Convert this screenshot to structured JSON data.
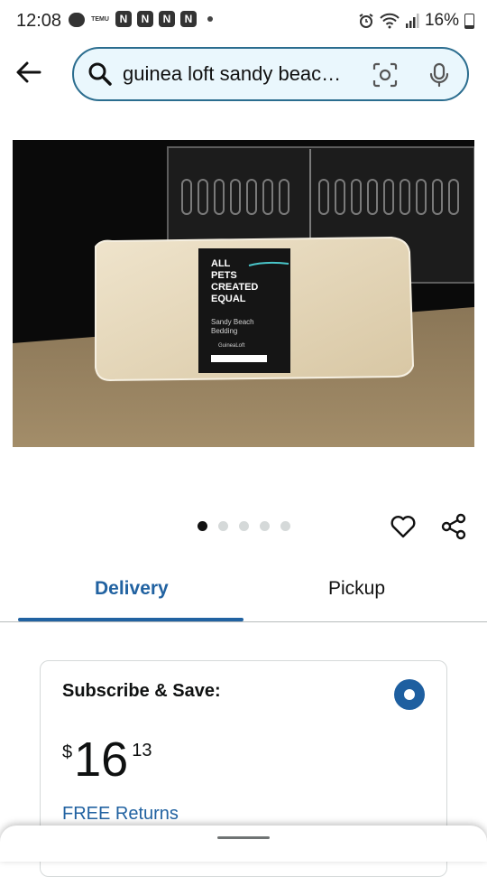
{
  "status_bar": {
    "time": "12:08",
    "temu_label": "TEMU",
    "n_icon_letter": "N",
    "battery": "16%"
  },
  "search": {
    "query": "guinea loft sandy beac…"
  },
  "product_image": {
    "label_lines": [
      "ALL",
      "PETS",
      "CREATED",
      "EQUAL"
    ],
    "label_sub": [
      "Sandy Beach",
      "Bedding"
    ],
    "brand": "GuineaLoft"
  },
  "gallery": {
    "total": 5,
    "active": 0
  },
  "tabs": {
    "delivery": "Delivery",
    "pickup": "Pickup"
  },
  "subscribe": {
    "title": "Subscribe & Save:",
    "currency": "$",
    "price_whole": "16",
    "price_fraction": "13",
    "returns": "FREE Returns"
  },
  "colors": {
    "accent": "#2162a1",
    "search_border": "#2b6d8f",
    "search_bg": "#eaf7fd"
  }
}
